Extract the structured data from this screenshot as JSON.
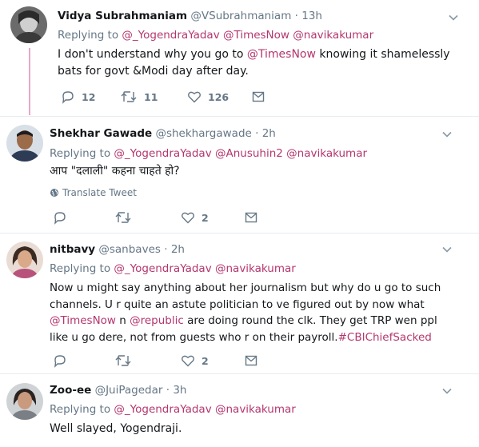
{
  "tweets": [
    {
      "name": "Vidya Subrahmaniam",
      "handle": "@VSubrahmaniam",
      "dot": "·",
      "time": "13h",
      "replying_prefix": "Replying to",
      "mentions": [
        "@_YogendraYadav",
        "@TimesNow",
        "@navikakumar"
      ],
      "text_parts": [
        "I don't understand why you go to ",
        "@TimesNow",
        " knowing it shamelessly bats for govt &Modi day after day."
      ],
      "replies": "12",
      "retweets": "11",
      "likes": "126",
      "icons": [
        "reply-icon",
        "retweet-icon",
        "like-icon",
        "message-icon"
      ]
    },
    {
      "name": "Shekhar Gawade",
      "handle": "@shekhargawade",
      "dot": "·",
      "time": "2h",
      "replying_prefix": "Replying to",
      "mentions": [
        "@_YogendraYadav",
        "@Anusuhin2",
        "@navikakumar"
      ],
      "text": "आप \"दलाली\" कहना चाहते हो?",
      "translate_label": "Translate Tweet",
      "replies": "",
      "retweets": "",
      "likes": "2"
    },
    {
      "name": "nitbavy",
      "handle": "@sanbaves",
      "dot": "·",
      "time": "2h",
      "replying_prefix": "Replying to",
      "mentions": [
        "@_YogendraYadav",
        "@navikakumar"
      ],
      "text_parts": [
        "Now u might say anything about her journalism but why do u go to such channels. U r quite an astute politician to ve figured out by now what ",
        "@TimesNow",
        " n ",
        "@republic",
        " are doing round the clk. They get TRP wen ppl like u go dere, not from guests who r on their payroll.",
        "#CBIChiefSacked"
      ],
      "replies": "",
      "retweets": "",
      "likes": "2"
    },
    {
      "name": "Zoo-ee",
      "handle": "@JuiPagedar",
      "dot": "·",
      "time": "3h",
      "replying_prefix": "Replying to",
      "mentions": [
        "@_YogendraYadav",
        "@navikakumar"
      ],
      "text": "Well slayed, Yogendraji."
    }
  ],
  "colors": {
    "link": "#b4366e",
    "muted": "#657786",
    "thread_line": "#e8a8c8",
    "divider": "#e6ecf0"
  }
}
